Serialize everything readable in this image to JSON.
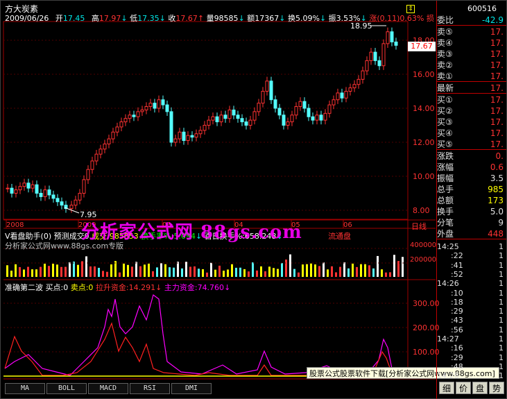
{
  "header": {
    "stock_name": "方大炭素",
    "date": "2009/06/26",
    "open_label": "开",
    "open_value": "17.45",
    "high_label": "高",
    "high_value": "17.97",
    "low_label": "低",
    "low_value": "17.35",
    "close_label": "收",
    "close_value": "17.67",
    "vol_label": "量",
    "vol_value": "98585",
    "amount_label": "额",
    "amount_value": "17367",
    "turnover_label": "换",
    "turnover_value": "5.09%",
    "amplitude_label": "振",
    "amplitude_value": "3.53%",
    "change_label": "涨",
    "change_value": "(0.11)",
    "change_pct": "0.63%",
    "trail": "损"
  },
  "price_axis": {
    "ticks": [
      "18.00",
      "16.00",
      "14.00",
      "12.00",
      "10.00",
      "8.00"
    ],
    "current_price": "17.67",
    "high_mark": "18.95",
    "low_mark": "7.95",
    "date_label": "日线"
  },
  "date_strip": [
    "2008",
    "2009",
    "03",
    "04",
    "05",
    "06"
  ],
  "indicator1": {
    "title": "V看盘助手(0)",
    "predict_label": "预测成交",
    "predict_value": "0",
    "line1": "成交:985853",
    "line2": "换手率%:5.094",
    "line3": "百日换手%:658.248",
    "flow": "流通盘",
    "watermark": "分析家公式网www.88gs.com专版",
    "axis": [
      "400000",
      "200000"
    ]
  },
  "indicator2": {
    "title": "准确第二波",
    "buy": "买点:0",
    "sell": "卖点:0",
    "pull": "拉升资金:14.291",
    "main": "主力资金:74.760",
    "axis": [
      "300.00",
      "200.00",
      "100.00"
    ]
  },
  "watermark_big": "分析家公式网 88gs.com",
  "promo": "股票公式股票软件下载[分析家公式网www.88gs.com]",
  "tabs": [
    "MA",
    "BOLL",
    "MACD",
    "RSI",
    "DMI"
  ],
  "quote_panel": {
    "code": "600516",
    "weibi_label": "委比",
    "weibi_value": "-42.9",
    "sell_labels": [
      "卖⑤",
      "卖④",
      "卖③",
      "卖②",
      "卖①"
    ],
    "sell_values": [
      "17.",
      "17.",
      "17.",
      "17.",
      "17."
    ],
    "latest_label": "最新",
    "latest_value": "17.",
    "buy_labels": [
      "买①",
      "买②",
      "买③",
      "买④",
      "买⑤"
    ],
    "buy_values": [
      "17.",
      "17.",
      "17.",
      "17.",
      "17."
    ],
    "stats_labels": [
      "涨跌",
      "涨幅",
      "振幅",
      "总手",
      "总额",
      "换手",
      "分笔"
    ],
    "stats_values": [
      "0.",
      "0.6",
      "3.5",
      "985",
      "173",
      "5.0",
      "9"
    ],
    "outer_label": "外盘",
    "outer_value": "448",
    "ticks": [
      {
        "t": "14:25",
        "v": "1"
      },
      {
        "t": ":22",
        "v": "1"
      },
      {
        "t": ":41",
        "v": "1"
      },
      {
        "t": ":52",
        "v": "1"
      },
      {
        "t": "14:26",
        "v": "1"
      },
      {
        "t": ":10",
        "v": "1"
      },
      {
        "t": ":18",
        "v": "1"
      },
      {
        "t": ":29",
        "v": "1"
      },
      {
        "t": ":43",
        "v": "1"
      },
      {
        "t": ":56",
        "v": "1"
      },
      {
        "t": "14:27",
        "v": "1"
      },
      {
        "t": ":16",
        "v": "1"
      },
      {
        "t": ":29",
        "v": "1"
      },
      {
        "t": ":48",
        "v": "1"
      },
      {
        "t": "14:28",
        "v": "1"
      }
    ],
    "bottom_tabs": [
      "细",
      "价",
      "盘",
      "势"
    ]
  }
}
